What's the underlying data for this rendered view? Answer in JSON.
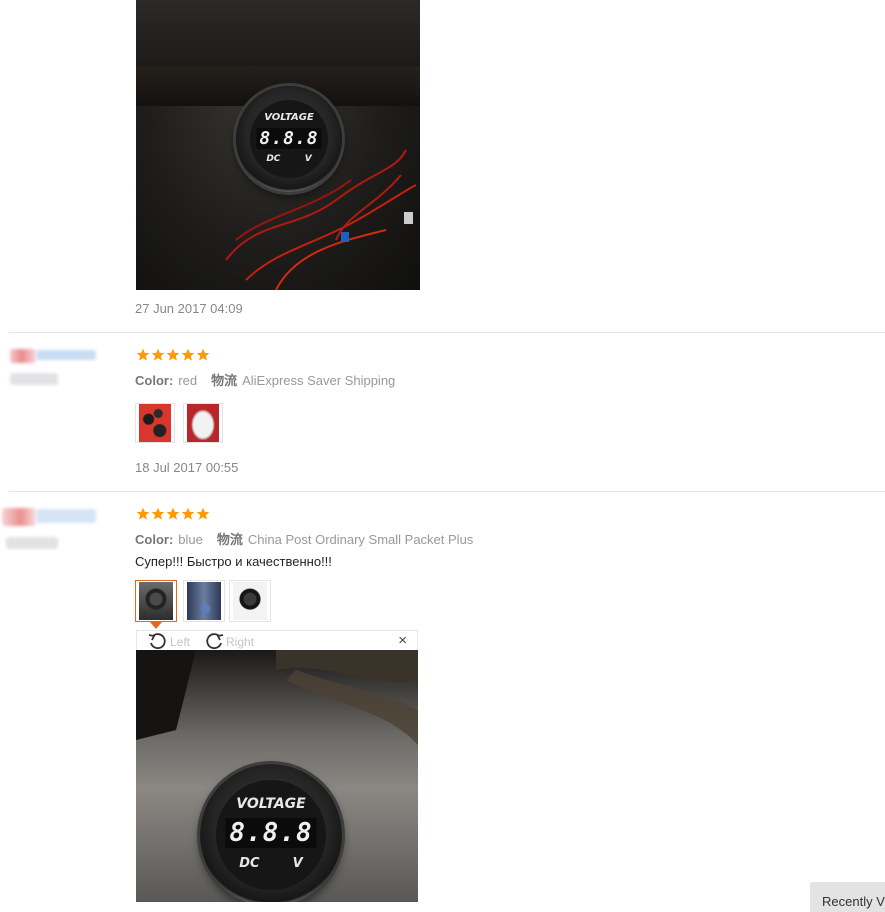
{
  "reviews": [
    {
      "date": "27 Jun 2017 04:09",
      "photo_text": {
        "top": "VOLTAGE",
        "digits": "8.8.8",
        "bottom_left": "DC",
        "bottom_right": "V"
      }
    },
    {
      "rating": 5,
      "color_label": "Color:",
      "color_value": "red",
      "shipping_label": "物流",
      "shipping_value": "AliExpress Saver Shipping",
      "thumbnails": [
        "red-photo-1",
        "red-photo-2"
      ],
      "date": "18 Jul 2017 00:55"
    },
    {
      "rating": 5,
      "color_label": "Color:",
      "color_value": "blue",
      "shipping_label": "物流",
      "shipping_value": "China Post Ordinary Small Packet Plus",
      "comment": "Супер!!! Быстро и качественно!!!",
      "thumbnails": [
        "gauge-photo-1",
        "gauge-photo-2",
        "gauge-photo-3"
      ],
      "viewer": {
        "rotate_left": "Left",
        "rotate_right": "Right",
        "close": "×",
        "photo_text": {
          "top": "VOLTAGE",
          "digits": "8.8.8",
          "bottom_left": "DC",
          "bottom_right": "V"
        }
      }
    }
  ],
  "recently_viewed_label": "Recently V",
  "colors": {
    "star": "#ff9a00",
    "accent": "#e46a1b",
    "muted": "#999999"
  },
  "icons": [
    "star-icon",
    "rotate-left-icon",
    "rotate-right-icon",
    "close-icon"
  ]
}
